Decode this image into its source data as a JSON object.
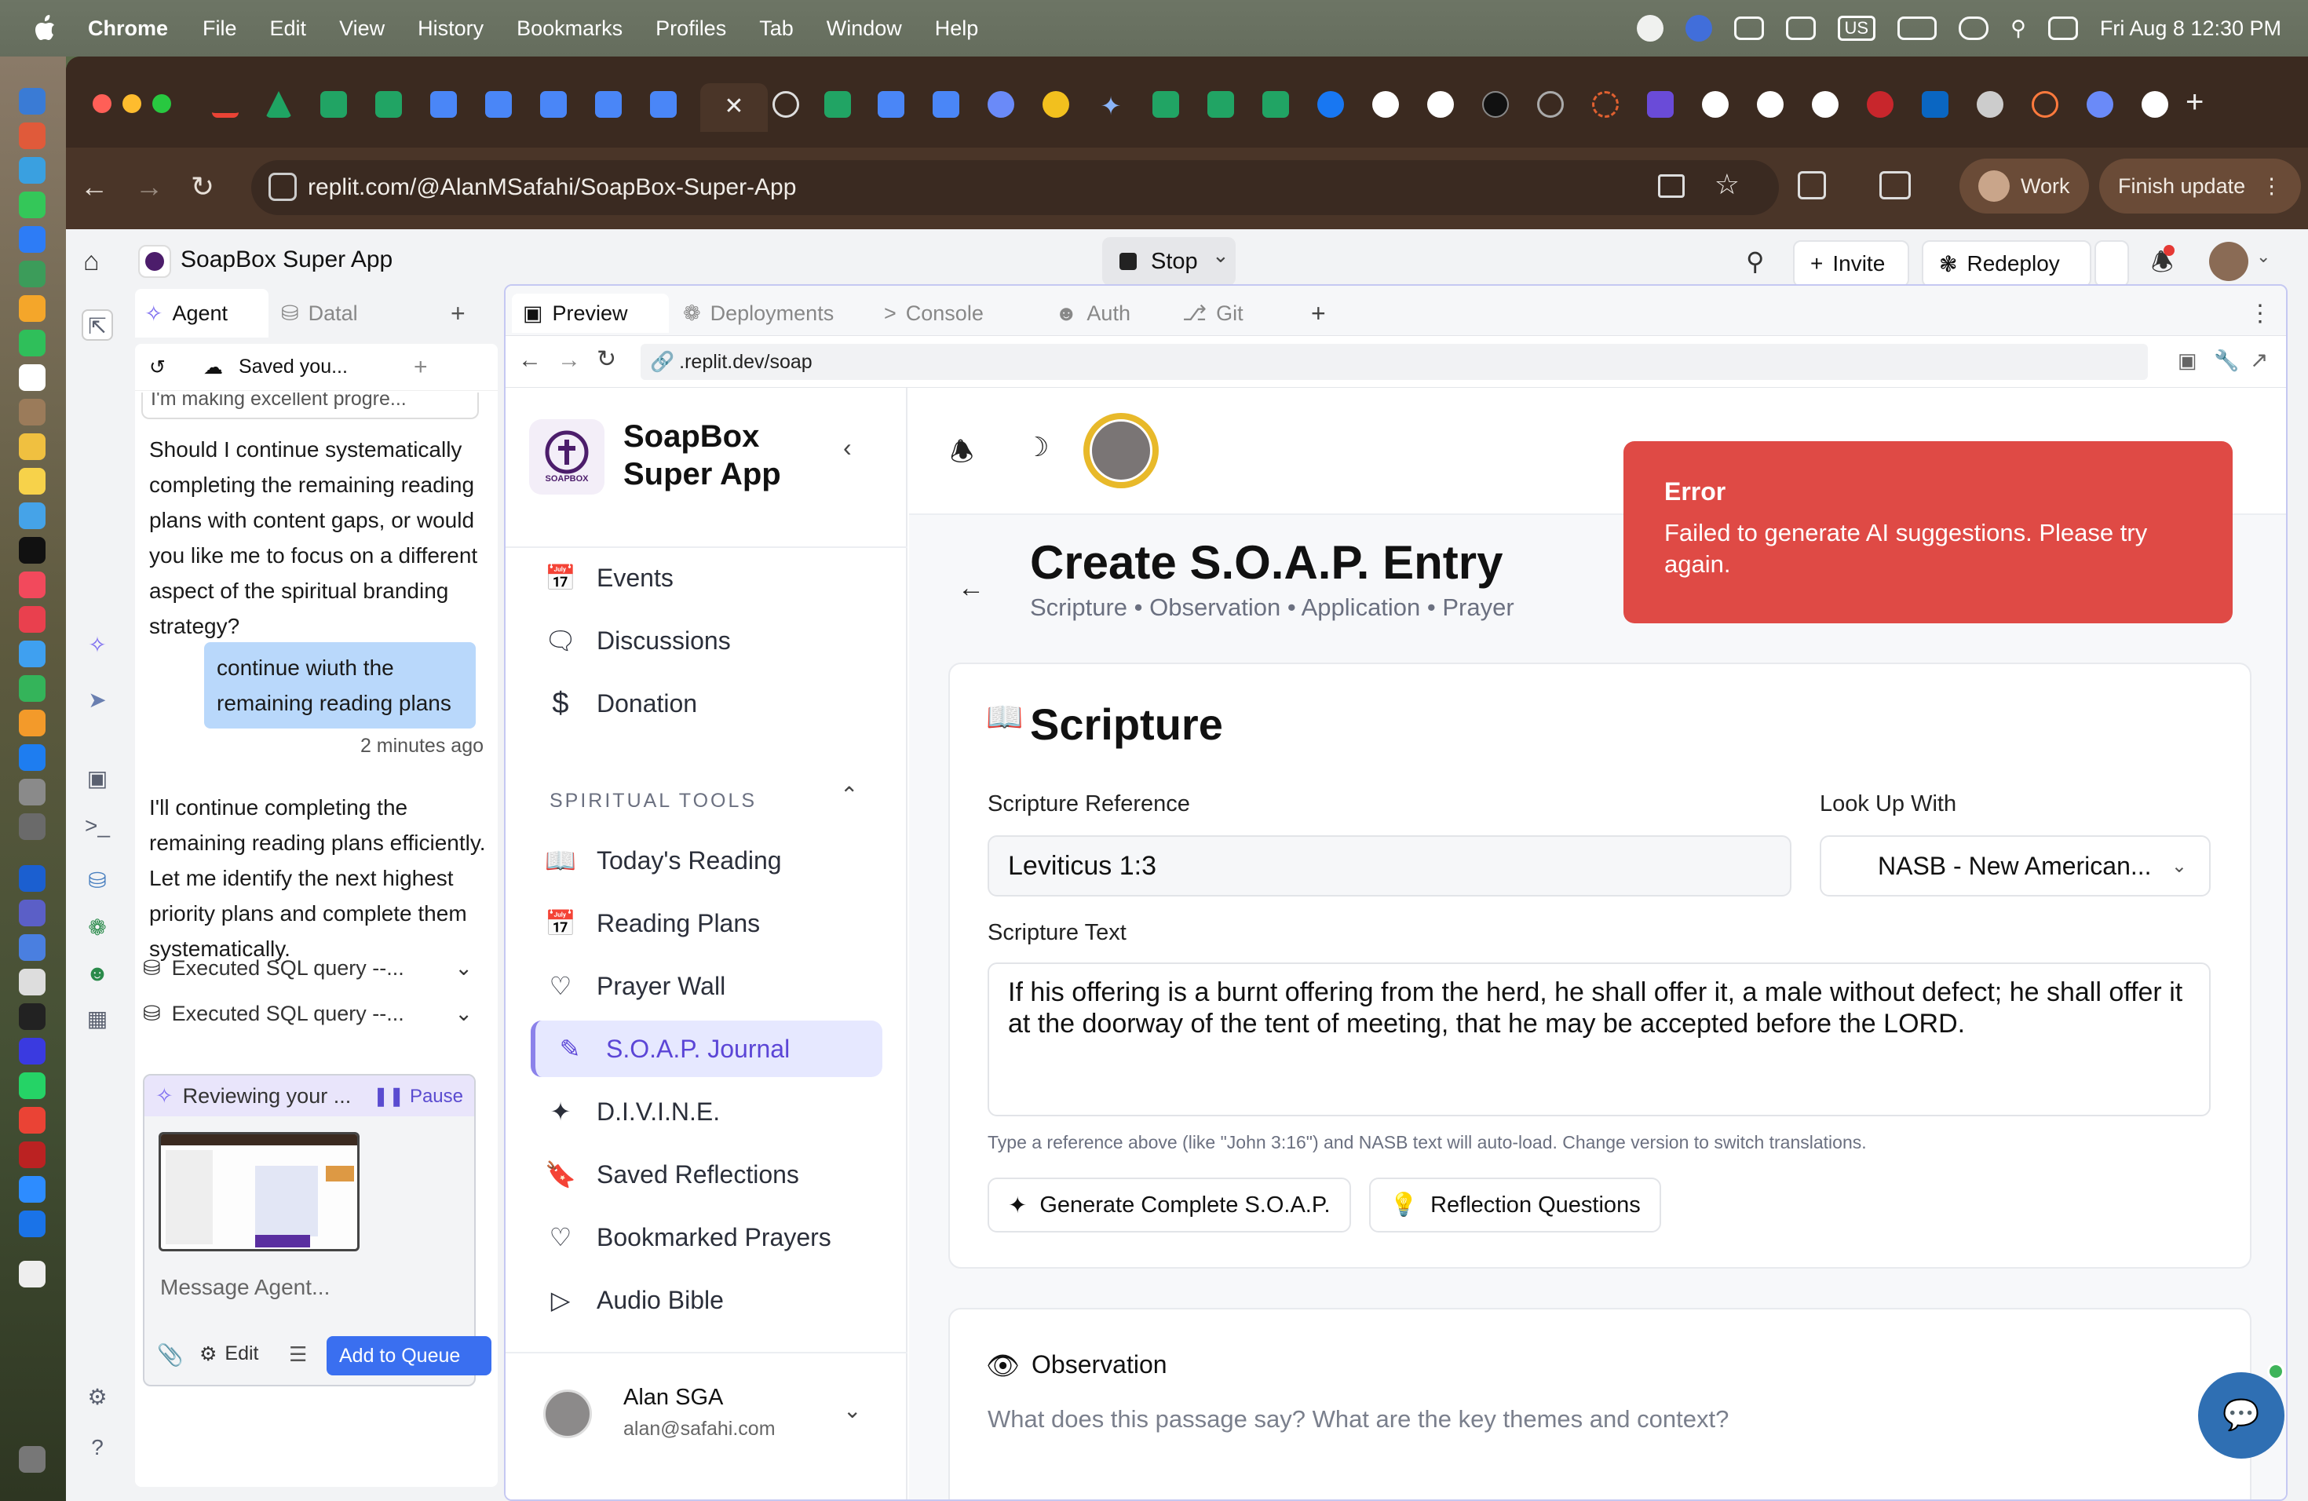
{
  "menubar": {
    "app": "Chrome",
    "items": [
      "File",
      "Edit",
      "View",
      "History",
      "Bookmarks",
      "Profiles",
      "Tab",
      "Window",
      "Help"
    ],
    "datetime": "Fri Aug 8  12:30 PM",
    "input_source": "US"
  },
  "browser": {
    "url": "replit.com/@AlanMSafahi/SoapBox-Super-App",
    "profile": "Work",
    "finish_update": "Finish update"
  },
  "replit": {
    "app_title": "SoapBox Super App",
    "stop": "Stop",
    "invite": "Invite",
    "redeploy": "Redeploy"
  },
  "agent": {
    "tab_agent": "Agent",
    "tab_database": "Datal",
    "saved": "Saved you...",
    "faded_line": "I'm making excellent progre...",
    "msg1": "Should I continue systematically completing the remaining reading plans with content gaps, or would you like me to focus on a different aspect of the spiritual branding strategy?",
    "user_msg": "continue wiuth the remaining reading plans",
    "user_time": "2 minutes ago",
    "msg2": "I'll continue completing the remaining reading plans efficiently. Let me identify the next highest priority plans and complete them systematically.",
    "sql1": "Executed SQL query --...",
    "sql2": "Executed SQL query --...",
    "status": "Reviewing your ...",
    "pause": "Pause",
    "placeholder": "Message Agent...",
    "edit": "Edit",
    "add_queue": "Add to Queue"
  },
  "workspace": {
    "tabs": [
      "Preview",
      "Deployments",
      "Console",
      "Auth",
      "Git"
    ],
    "preview_url": ".replit.dev/soap"
  },
  "soapbox": {
    "brand": "SoapBox Super App",
    "logo_text": "SOAPBOX",
    "nav_top": [
      "Events",
      "Discussions",
      "Donation"
    ],
    "section": "SPIRITUAL TOOLS",
    "nav_tools": [
      "Today's Reading",
      "Reading Plans",
      "Prayer Wall",
      "S.O.A.P. Journal",
      "D.I.V.I.N.E.",
      "Saved Reflections",
      "Bookmarked Prayers",
      "Audio Bible"
    ],
    "active_nav": "S.O.A.P. Journal",
    "user_name": "Alan SGA",
    "user_email": "alan@safahi.com",
    "page_title": "Create S.O.A.P. Entry",
    "page_subtitle": "Scripture • Observation • Application • Prayer",
    "scripture_heading": "Scripture",
    "ref_label": "Scripture Reference",
    "ref_value": "Leviticus 1:3",
    "lookup_label": "Look Up With",
    "lookup_value": "NASB - New American...",
    "text_label": "Scripture Text",
    "text_value": "If his offering is a burnt offering from the herd, he shall offer it, a male without defect; he shall offer it at the doorway of the tent of meeting, that he may be accepted before the LORD.",
    "help": "Type a reference above (like \"John 3:16\") and NASB text will auto-load. Change version to switch translations.",
    "gen_btn": "Generate Complete S.O.A.P.",
    "reflect_btn": "Reflection Questions",
    "obs_heading": "Observation",
    "obs_placeholder": "What does this passage say? What are the key themes and context?"
  },
  "toast": {
    "title": "Error",
    "message": "Failed to generate AI suggestions. Please try again."
  },
  "colors": {
    "accent": "#7c3aed",
    "error": "#df4a45",
    "active_nav_bg": "#e6e8ff"
  }
}
